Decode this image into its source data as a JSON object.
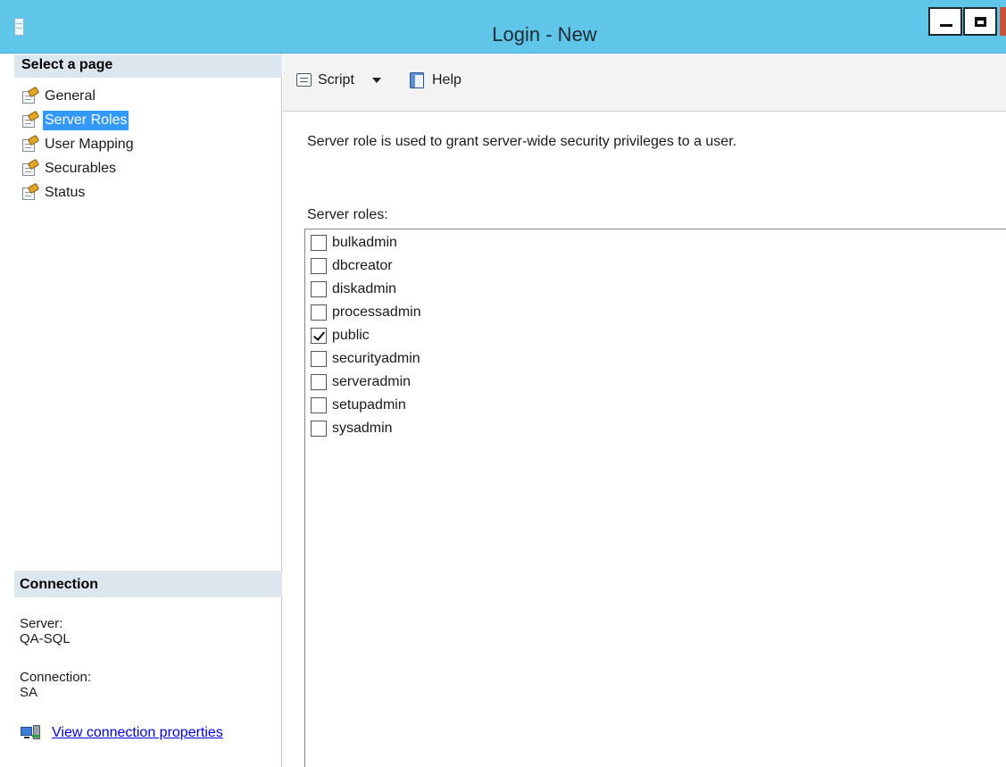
{
  "window": {
    "title": "Login - New"
  },
  "left": {
    "pages_header": "Select a page",
    "pages": [
      {
        "label": "General"
      },
      {
        "label": "Server Roles"
      },
      {
        "label": "User Mapping"
      },
      {
        "label": "Securables"
      },
      {
        "label": "Status"
      }
    ],
    "connection_header": "Connection",
    "server_label": "Server:",
    "server_value": "QA-SQL",
    "connection_label": "Connection:",
    "connection_value": "SA",
    "view_properties_link": "View connection properties"
  },
  "toolbar": {
    "script_label": "Script",
    "help_label": "Help"
  },
  "main": {
    "description": "Server role is used to grant server-wide security privileges to a user.",
    "roles_label": "Server roles:",
    "roles": [
      {
        "label": "bulkadmin",
        "checked": false
      },
      {
        "label": "dbcreator",
        "checked": false
      },
      {
        "label": "diskadmin",
        "checked": false
      },
      {
        "label": "processadmin",
        "checked": false
      },
      {
        "label": "public",
        "checked": true
      },
      {
        "label": "securityadmin",
        "checked": false
      },
      {
        "label": "serveradmin",
        "checked": false
      },
      {
        "label": "setupadmin",
        "checked": false
      },
      {
        "label": "sysadmin",
        "checked": false
      }
    ]
  },
  "selected_page": "Server Roles",
  "colors": {
    "titlebar": "#5fc6ea",
    "selection": "#3399ff",
    "section_header": "#dce6ee",
    "link": "#0000ee"
  }
}
